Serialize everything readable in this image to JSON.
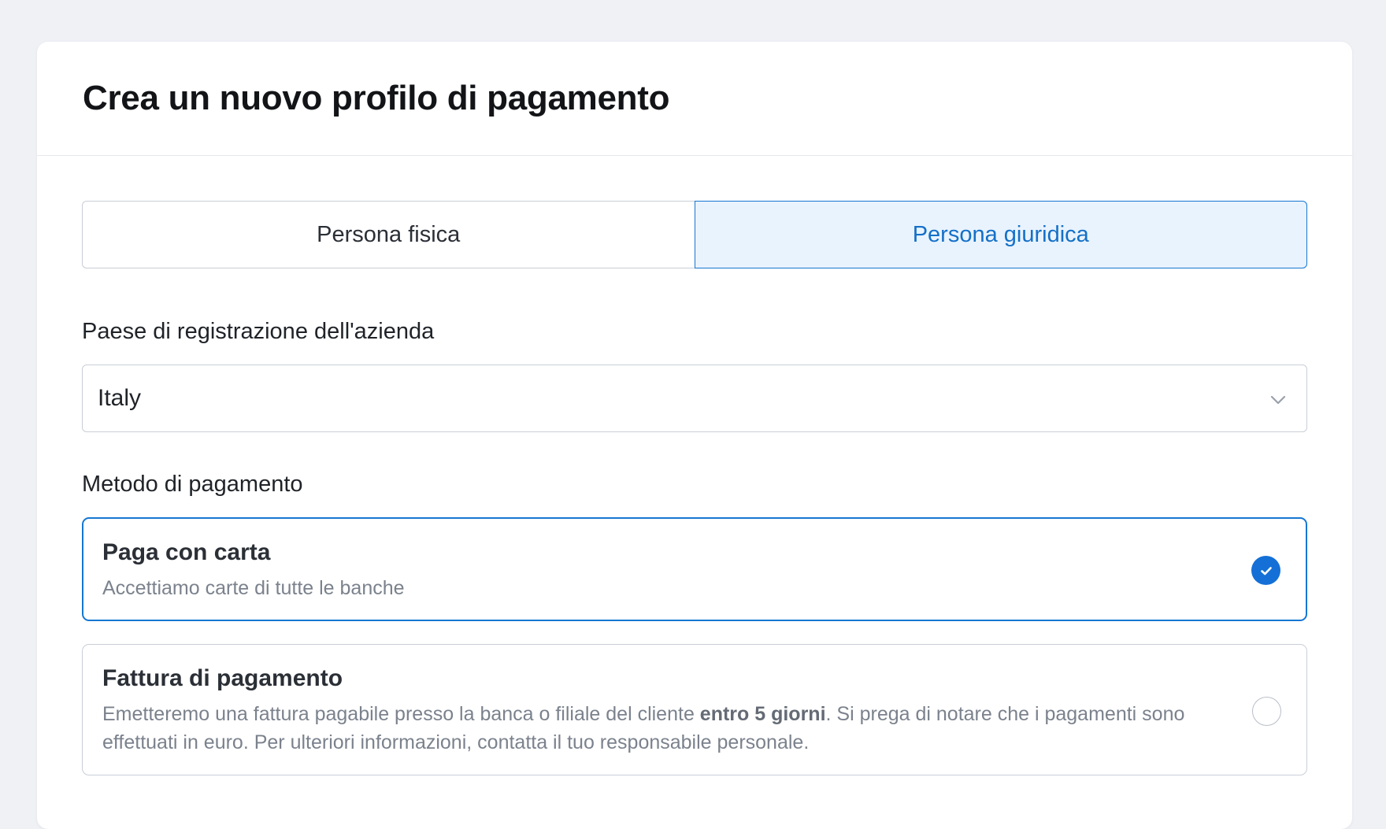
{
  "header": {
    "title": "Crea un nuovo profilo di pagamento"
  },
  "entity_toggle": {
    "options": [
      "Persona fisica",
      "Persona giuridica"
    ],
    "selected": "Persona giuridica"
  },
  "country": {
    "label": "Paese di registrazione dell'azienda",
    "value": "Italy"
  },
  "payment": {
    "label": "Metodo di pagamento",
    "methods": [
      {
        "title": "Paga con carta",
        "description": "Accettiamo carte di tutte le banche",
        "selected": true
      },
      {
        "title": "Fattura di pagamento",
        "description_before": "Emetteremo una fattura pagabile presso la banca o filiale del cliente ",
        "description_bold": "entro 5 giorni",
        "description_after": ". Si prega di notare che i pagamenti sono effettuati in euro. Per ulteriori informazioni, contatta il tuo responsabile personale.",
        "selected": false
      }
    ]
  },
  "colors": {
    "accent": "#1677d2",
    "accent_bg": "#e9f3fe",
    "page_bg": "#eff1f5"
  },
  "icons": {
    "select_arrow": "chevron-down-icon",
    "selected_mark": "check-circle-icon",
    "unselected_mark": "radio-empty-icon"
  }
}
